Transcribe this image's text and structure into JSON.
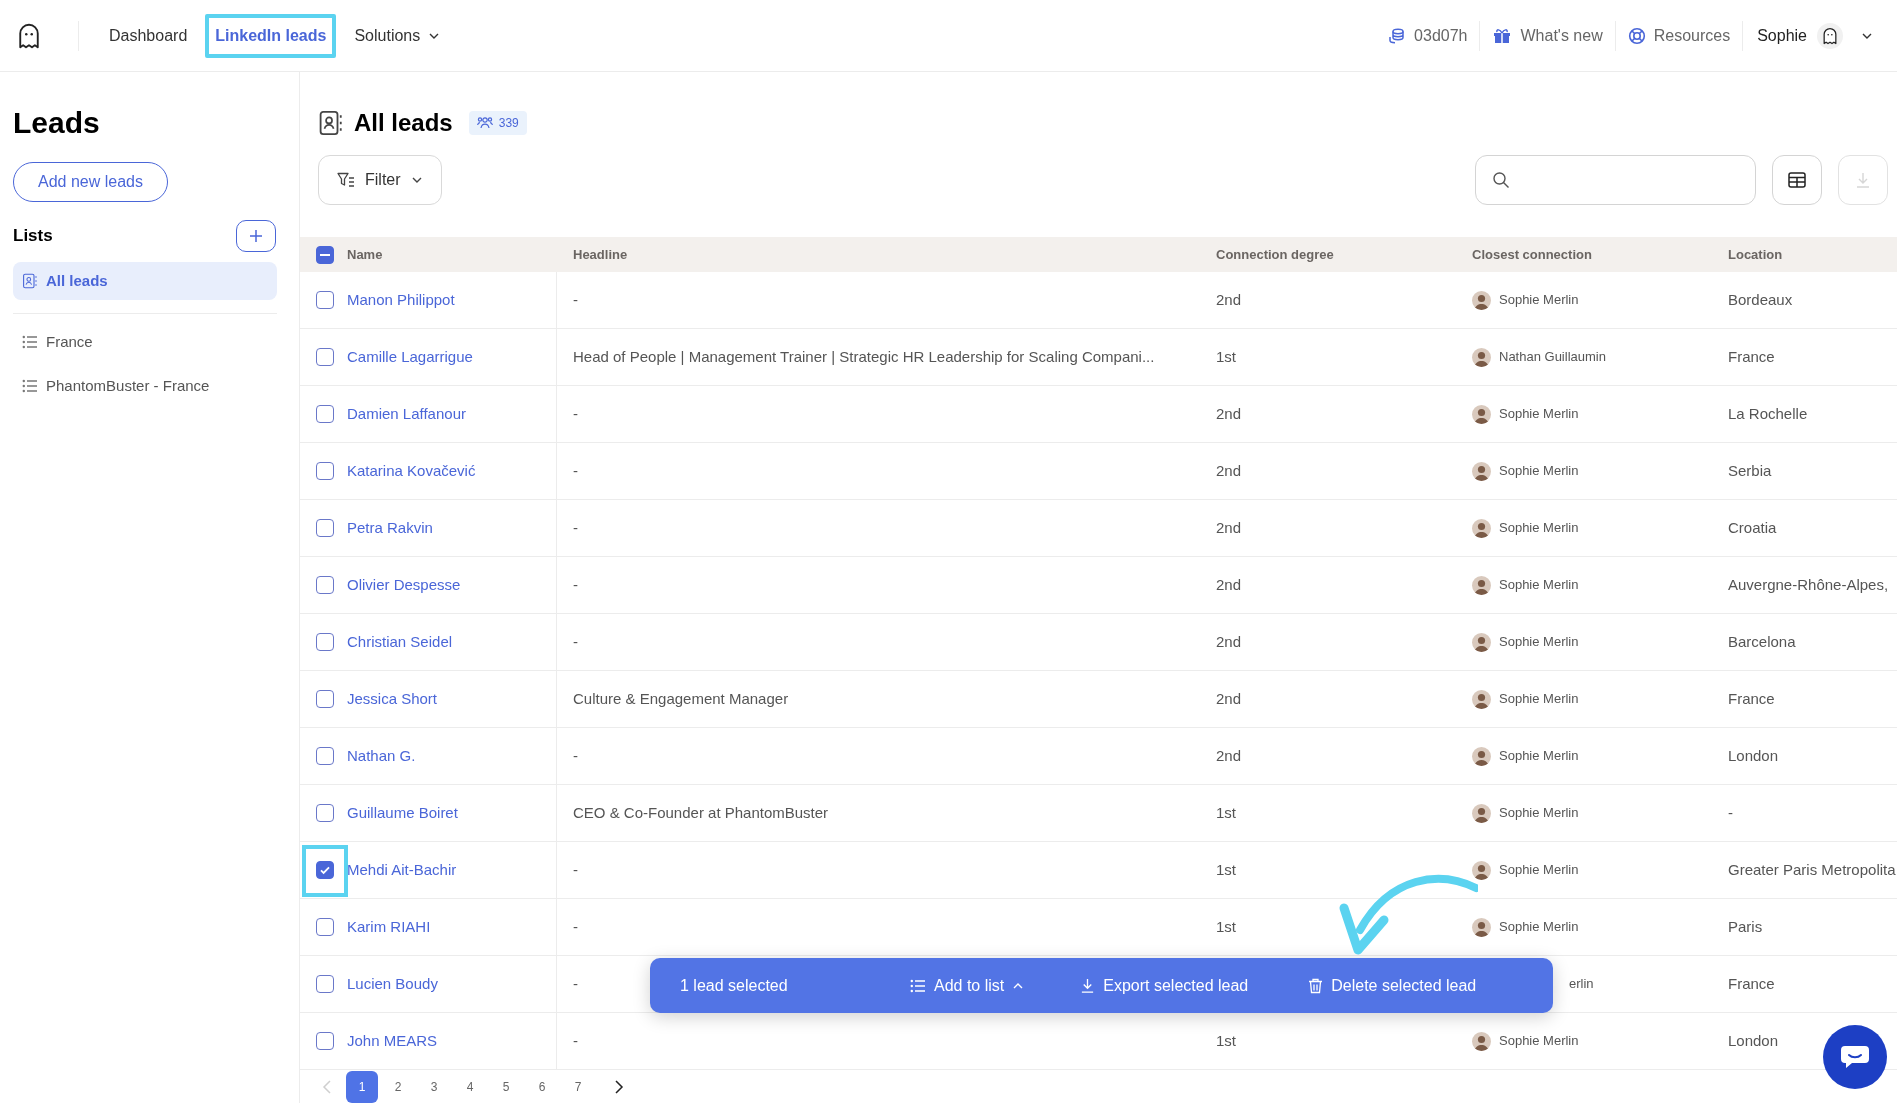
{
  "nav": {
    "items": [
      {
        "label": "Dashboard",
        "selected": false,
        "highlighted": false,
        "kind": "link"
      },
      {
        "label": "LinkedIn leads",
        "selected": true,
        "highlighted": true,
        "kind": "link"
      },
      {
        "label": "Solutions",
        "selected": false,
        "highlighted": false,
        "kind": "menu"
      }
    ],
    "credits": "03d07h",
    "whats_new": "What's new",
    "resources": "Resources",
    "user": "Sophie"
  },
  "sidebar": {
    "title": "Leads",
    "add_button": "Add new leads",
    "lists_heading": "Lists",
    "lists": [
      {
        "label": "All leads",
        "selected": true,
        "kind": "all"
      },
      {
        "label": "France",
        "selected": false,
        "kind": "list"
      },
      {
        "label": "PhantomBuster - France",
        "selected": false,
        "kind": "list"
      }
    ]
  },
  "main": {
    "title": "All leads",
    "count": "339",
    "filter": "Filter"
  },
  "table": {
    "some_selected": true,
    "columns": [
      "Name",
      "Headline",
      "Connection degree",
      "Closest connection",
      "Location"
    ],
    "rows": [
      {
        "name": "Manon Philippot",
        "checked": false,
        "highlighted": false,
        "headline": "-",
        "degree": "2nd",
        "connection": "Sophie Merlin",
        "location": "Bordeaux"
      },
      {
        "name": "Camille Lagarrigue",
        "checked": false,
        "highlighted": false,
        "headline": "Head of People | Management Trainer | Strategic HR Leadership for Scaling Compani...",
        "degree": "1st",
        "connection": "Nathan Guillaumin",
        "location": "France"
      },
      {
        "name": "Damien Laffanour",
        "checked": false,
        "highlighted": false,
        "headline": "-",
        "degree": "2nd",
        "connection": "Sophie Merlin",
        "location": "La Rochelle"
      },
      {
        "name": "Katarina Kovačević",
        "checked": false,
        "highlighted": false,
        "headline": "-",
        "degree": "2nd",
        "connection": "Sophie Merlin",
        "location": "Serbia"
      },
      {
        "name": "Petra Rakvin",
        "checked": false,
        "highlighted": false,
        "headline": "-",
        "degree": "2nd",
        "connection": "Sophie Merlin",
        "location": "Croatia"
      },
      {
        "name": "Olivier Despesse",
        "checked": false,
        "highlighted": false,
        "headline": "-",
        "degree": "2nd",
        "connection": "Sophie Merlin",
        "location": "Auvergne-Rhône-Alpes,"
      },
      {
        "name": "Christian Seidel",
        "checked": false,
        "highlighted": false,
        "headline": "-",
        "degree": "2nd",
        "connection": "Sophie Merlin",
        "location": "Barcelona"
      },
      {
        "name": "Jessica Short",
        "checked": false,
        "highlighted": false,
        "headline": "Culture & Engagement Manager",
        "degree": "2nd",
        "connection": "Sophie Merlin",
        "location": "France"
      },
      {
        "name": "Nathan G.",
        "checked": false,
        "highlighted": false,
        "headline": "-",
        "degree": "2nd",
        "connection": "Sophie Merlin",
        "location": "London"
      },
      {
        "name": "Guillaume Boiret",
        "checked": false,
        "highlighted": false,
        "headline": "CEO & Co-Founder at PhantomBuster",
        "degree": "1st",
        "connection": "Sophie Merlin",
        "location": "-"
      },
      {
        "name": "Mehdi Ait-Bachir",
        "checked": true,
        "highlighted": true,
        "headline": "-",
        "degree": "1st",
        "connection": "Sophie Merlin",
        "location": "Greater Paris Metropolita"
      },
      {
        "name": "Karim RIAHI",
        "checked": false,
        "highlighted": false,
        "headline": "-",
        "degree": "1st",
        "connection": "Sophie Merlin",
        "location": "Paris"
      },
      {
        "name": "Lucien Boudy",
        "checked": false,
        "highlighted": false,
        "headline": "-",
        "connection_cut": "erlin",
        "location": "France"
      },
      {
        "name": "John MEARS",
        "checked": false,
        "highlighted": false,
        "headline": "-",
        "degree": "1st",
        "connection": "Sophie Merlin",
        "location": "London"
      }
    ]
  },
  "pagination": {
    "prev_disabled": true,
    "pages": [
      {
        "label": "1",
        "selected": true
      },
      {
        "label": "2",
        "selected": false
      },
      {
        "label": "3",
        "selected": false
      },
      {
        "label": "4",
        "selected": false
      },
      {
        "label": "5",
        "selected": false
      },
      {
        "label": "6",
        "selected": false
      },
      {
        "label": "7",
        "selected": false
      }
    ]
  },
  "action_bar": {
    "summary": "1 lead selected",
    "actions": [
      {
        "label": "Add to list",
        "kind": "menu"
      },
      {
        "label": "Export selected lead",
        "kind": "export"
      },
      {
        "label": "Delete selected lead",
        "kind": "delete"
      }
    ]
  }
}
